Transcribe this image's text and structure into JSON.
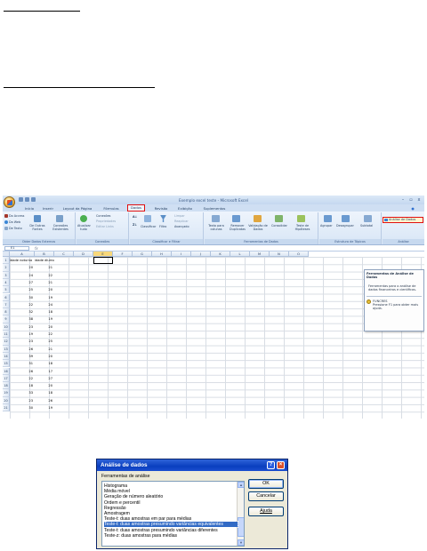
{
  "excel": {
    "window_title": "Exemplo excel teste - Microsoft Excel",
    "window_controls": [
      "–",
      "▫",
      "x"
    ],
    "tabs": [
      "Início",
      "Inserir",
      "Layout da Página",
      "Fórmulas",
      "Dados",
      "Revisão",
      "Exibição",
      "Suplementos"
    ],
    "active_tab": "Dados",
    "ribbon": {
      "external_data": {
        "label": "Obter Dados Externos",
        "buttons": [
          "Do Access",
          "Da Web",
          "De Texto",
          "De Outras Fontes",
          "Conexões Existentes"
        ]
      },
      "connections": {
        "label": "Conexões",
        "refresh": "Atualizar tudo",
        "buttons": [
          "Conexões",
          "Propriedades",
          "Editar Links"
        ]
      },
      "sort_filter": {
        "label": "Classificar e Filtrar",
        "sort": "Classificar",
        "filter": "Filtro",
        "buttons": [
          "Limpar",
          "Reaplicar",
          "Avançado"
        ]
      },
      "data_tools": {
        "label": "Ferramentas de Dados",
        "buttons": [
          "Texto para colunas",
          "Remover Duplicatas",
          "Validação de Dados",
          "Consolidar",
          "Teste de Hipóteses"
        ]
      },
      "outline": {
        "label": "Estrutura de Tópicos",
        "buttons": [
          "Agrupar",
          "Desagrupar",
          "Subtotal"
        ]
      },
      "analysis": {
        "label": "Análise",
        "button": "Análise de Dados"
      }
    },
    "name_box": "E1",
    "fx": "fx",
    "columns": [
      "A",
      "B",
      "C",
      "D",
      "E",
      "F",
      "G",
      "H",
      "I",
      "J",
      "K",
      "L",
      "M",
      "N",
      "O"
    ],
    "selected_column": "E",
    "headers": [
      "idade noturno",
      "idade diurno"
    ],
    "rows": [
      [
        20,
        21
      ],
      [
        24,
        22
      ],
      [
        27,
        21
      ],
      [
        25,
        20
      ],
      [
        30,
        19
      ],
      [
        22,
        24
      ],
      [
        32,
        18
      ],
      [
        38,
        19
      ],
      [
        23,
        20
      ],
      [
        19,
        22
      ],
      [
        23,
        25
      ],
      [
        26,
        21
      ],
      [
        39,
        20
      ],
      [
        31,
        18
      ],
      [
        26,
        17
      ],
      [
        22,
        27
      ],
      [
        18,
        20
      ],
      [
        33,
        18
      ],
      [
        23,
        26
      ],
      [
        30,
        19
      ]
    ],
    "tooltip": {
      "title": "Ferramentas de Análise de Dados",
      "body": "Ferramentas para o análise de dados financeiros e científicos.",
      "addin_name": "FUNCRES",
      "addin_hint": "Pressione F1 para obter mais ajuda."
    }
  },
  "dialog": {
    "title": "Análise de dados",
    "list_label": "Ferramentas de análise",
    "items": [
      "Histograma",
      "Média móvel",
      "Geração de número aleatório",
      "Ordem e percentil",
      "Regressão",
      "Amostragem",
      "Teste-t: duas amostras em par para médias",
      "Teste-t: duas amostras presumindo variâncias equivalentes",
      "Teste-t: duas amostras presumindo variâncias diferentes",
      "Teste-z: duas amostras para médias"
    ],
    "selected_index": 7,
    "buttons": {
      "ok": "OK",
      "cancel": "Cancelar",
      "help": "Ajuda"
    },
    "help_glyph": "?",
    "close_glyph": "×",
    "scroll_up": "▲",
    "scroll_down": "▼"
  }
}
